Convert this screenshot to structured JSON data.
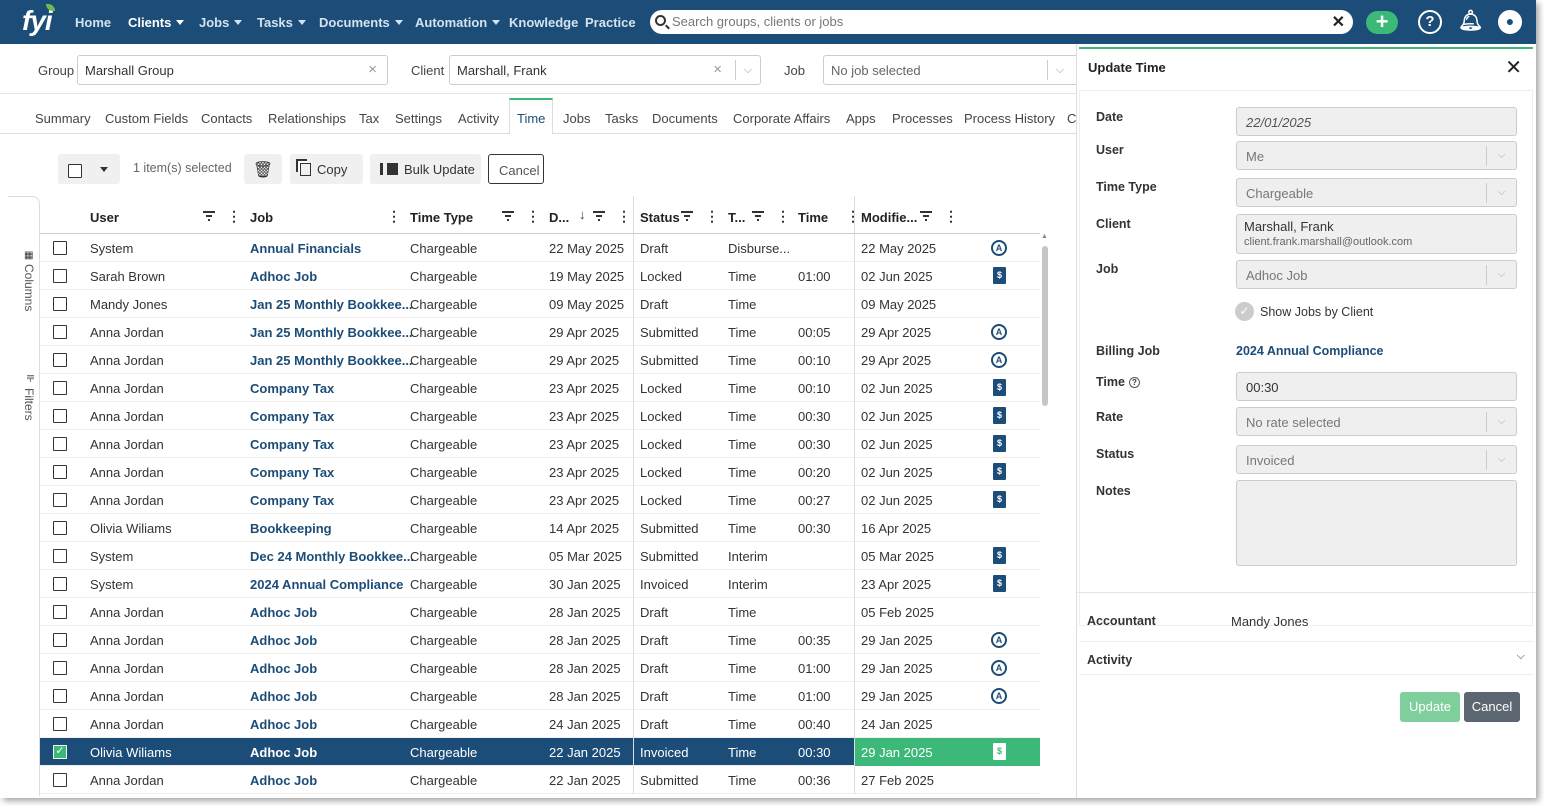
{
  "nav": {
    "logo": "fyi",
    "items": [
      "Home",
      "Clients",
      "Jobs",
      "Tasks",
      "Documents",
      "Automation",
      "Knowledge",
      "Practice"
    ],
    "search_placeholder": "Search groups, clients or jobs",
    "add_icon": "plus-icon",
    "help_icon": "help-icon",
    "bell_icon": "bell-icon",
    "user_icon": "user-icon"
  },
  "filters": {
    "group_label": "Group",
    "group_value": "Marshall Group",
    "client_label": "Client",
    "client_value": "Marshall, Frank",
    "job_label": "Job",
    "job_placeholder": "No job selected"
  },
  "tabs": [
    "Summary",
    "Custom Fields",
    "Contacts",
    "Relationships",
    "Tax",
    "Settings",
    "Activity",
    "Time",
    "Jobs",
    "Tasks",
    "Documents",
    "Corporate Affairs",
    "Apps",
    "Processes",
    "Process History",
    "C"
  ],
  "toolbar": {
    "selected_text": "1 item(s) selected",
    "copy_label": "Copy",
    "bulk_update_label": "Bulk Update",
    "cancel_label": "Cancel"
  },
  "side": {
    "columns_label": "Columns",
    "filters_label": "Filters"
  },
  "grid": {
    "headers": {
      "user": "User",
      "job": "Job",
      "time_type": "Time Type",
      "date": "D...",
      "status": "Status",
      "type": "T...",
      "time": "Time",
      "modified": "Modifie..."
    },
    "rows": [
      {
        "user": "System",
        "job": "Annual Financials",
        "time_type": "Chargeable",
        "date": "22 May 2025",
        "status": "Draft",
        "type": "Disburse...",
        "time": "",
        "modified": "22 May 2025",
        "icon": "a",
        "selected": false
      },
      {
        "user": "Sarah Brown",
        "job": "Adhoc Job",
        "time_type": "Chargeable",
        "date": "19 May 2025",
        "status": "Locked",
        "type": "Time",
        "time": "01:00",
        "modified": "02 Jun 2025",
        "icon": "d",
        "selected": false
      },
      {
        "user": "Mandy Jones",
        "job": "Jan 25 Monthly Bookkee...",
        "time_type": "Chargeable",
        "date": "09 May 2025",
        "status": "Draft",
        "type": "Time",
        "time": "",
        "modified": "09 May 2025",
        "icon": "",
        "selected": false
      },
      {
        "user": "Anna Jordan",
        "job": "Jan 25 Monthly Bookkee...",
        "time_type": "Chargeable",
        "date": "29 Apr 2025",
        "status": "Submitted",
        "type": "Time",
        "time": "00:05",
        "modified": "29 Apr 2025",
        "icon": "a",
        "selected": false
      },
      {
        "user": "Anna Jordan",
        "job": "Jan 25 Monthly Bookkee...",
        "time_type": "Chargeable",
        "date": "29 Apr 2025",
        "status": "Submitted",
        "type": "Time",
        "time": "00:10",
        "modified": "29 Apr 2025",
        "icon": "a",
        "selected": false
      },
      {
        "user": "Anna Jordan",
        "job": "Company Tax",
        "time_type": "Chargeable",
        "date": "23 Apr 2025",
        "status": "Locked",
        "type": "Time",
        "time": "00:10",
        "modified": "02 Jun 2025",
        "icon": "d",
        "selected": false
      },
      {
        "user": "Anna Jordan",
        "job": "Company Tax",
        "time_type": "Chargeable",
        "date": "23 Apr 2025",
        "status": "Locked",
        "type": "Time",
        "time": "00:30",
        "modified": "02 Jun 2025",
        "icon": "d",
        "selected": false
      },
      {
        "user": "Anna Jordan",
        "job": "Company Tax",
        "time_type": "Chargeable",
        "date": "23 Apr 2025",
        "status": "Locked",
        "type": "Time",
        "time": "00:30",
        "modified": "02 Jun 2025",
        "icon": "d",
        "selected": false
      },
      {
        "user": "Anna Jordan",
        "job": "Company Tax",
        "time_type": "Chargeable",
        "date": "23 Apr 2025",
        "status": "Locked",
        "type": "Time",
        "time": "00:20",
        "modified": "02 Jun 2025",
        "icon": "d",
        "selected": false
      },
      {
        "user": "Anna Jordan",
        "job": "Company Tax",
        "time_type": "Chargeable",
        "date": "23 Apr 2025",
        "status": "Locked",
        "type": "Time",
        "time": "00:27",
        "modified": "02 Jun 2025",
        "icon": "d",
        "selected": false
      },
      {
        "user": "Olivia Wiliams",
        "job": "Bookkeeping",
        "time_type": "Chargeable",
        "date": "14 Apr 2025",
        "status": "Submitted",
        "type": "Time",
        "time": "00:30",
        "modified": "16 Apr 2025",
        "icon": "",
        "selected": false
      },
      {
        "user": "System",
        "job": "Dec 24 Monthly Bookkee...",
        "time_type": "Chargeable",
        "date": "05 Mar 2025",
        "status": "Submitted",
        "type": "Interim",
        "time": "",
        "modified": "05 Mar 2025",
        "icon": "d",
        "selected": false
      },
      {
        "user": "System",
        "job": "2024 Annual Compliance",
        "time_type": "Chargeable",
        "date": "30 Jan 2025",
        "status": "Invoiced",
        "type": "Interim",
        "time": "",
        "modified": "23 Apr 2025",
        "icon": "d",
        "selected": false
      },
      {
        "user": "Anna Jordan",
        "job": "Adhoc Job",
        "time_type": "Chargeable",
        "date": "28 Jan 2025",
        "status": "Draft",
        "type": "Time",
        "time": "",
        "modified": "05 Feb 2025",
        "icon": "",
        "selected": false
      },
      {
        "user": "Anna Jordan",
        "job": "Adhoc Job",
        "time_type": "Chargeable",
        "date": "28 Jan 2025",
        "status": "Draft",
        "type": "Time",
        "time": "00:35",
        "modified": "29 Jan 2025",
        "icon": "a",
        "selected": false
      },
      {
        "user": "Anna Jordan",
        "job": "Adhoc Job",
        "time_type": "Chargeable",
        "date": "28 Jan 2025",
        "status": "Draft",
        "type": "Time",
        "time": "01:00",
        "modified": "29 Jan 2025",
        "icon": "a",
        "selected": false
      },
      {
        "user": "Anna Jordan",
        "job": "Adhoc Job",
        "time_type": "Chargeable",
        "date": "28 Jan 2025",
        "status": "Draft",
        "type": "Time",
        "time": "01:00",
        "modified": "29 Jan 2025",
        "icon": "a",
        "selected": false
      },
      {
        "user": "Anna Jordan",
        "job": "Adhoc Job",
        "time_type": "Chargeable",
        "date": "24 Jan 2025",
        "status": "Draft",
        "type": "Time",
        "time": "00:40",
        "modified": "24 Jan 2025",
        "icon": "",
        "selected": false
      },
      {
        "user": "Olivia Wiliams",
        "job": "Adhoc Job",
        "time_type": "Chargeable",
        "date": "22 Jan 2025",
        "status": "Invoiced",
        "type": "Time",
        "time": "00:30",
        "modified": "29 Jan 2025",
        "icon": "d",
        "selected": true
      },
      {
        "user": "Anna Jordan",
        "job": "Adhoc Job",
        "time_type": "Chargeable",
        "date": "22 Jan 2025",
        "status": "Submitted",
        "type": "Time",
        "time": "00:36",
        "modified": "27 Feb 2025",
        "icon": "",
        "selected": false
      }
    ]
  },
  "panel": {
    "title": "Update Time",
    "date_label": "Date",
    "date_value": "22/01/2025",
    "user_label": "User",
    "user_value": "Me",
    "time_type_label": "Time Type",
    "time_type_value": "Chargeable",
    "client_label": "Client",
    "client_name": "Marshall, Frank",
    "client_email": "client.frank.marshall@outlook.com",
    "job_label": "Job",
    "job_value": "Adhoc Job",
    "show_jobs_label": "Show Jobs by Client",
    "billing_job_label": "Billing Job",
    "billing_job_value": "2024 Annual Compliance",
    "time_label": "Time",
    "time_value": "00:30",
    "rate_label": "Rate",
    "rate_value": "No rate selected",
    "status_label": "Status",
    "status_value": "Invoiced",
    "notes_label": "Notes",
    "notes_value": "",
    "accountant_label": "Accountant",
    "accountant_value": "Mandy Jones",
    "activity_label": "Activity",
    "update_label": "Update",
    "cancel_label": "Cancel"
  },
  "colors": {
    "nav_bg": "#1c4d78",
    "accent_green": "#3cb878",
    "job_link": "#1c4d78",
    "selected_row": "#1c4d78"
  }
}
